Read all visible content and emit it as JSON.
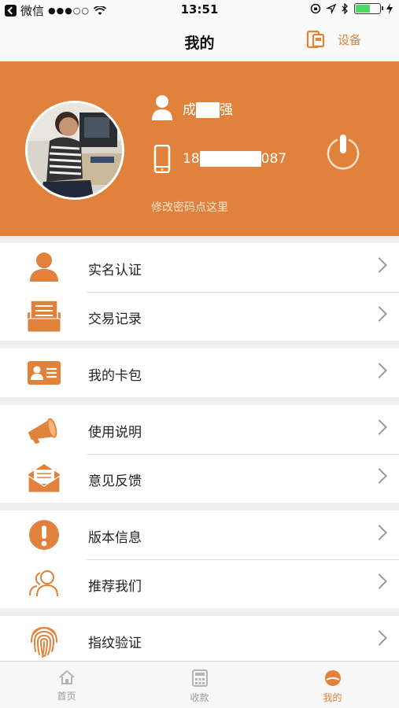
{
  "status_bar": {
    "carrier": "微信",
    "signal": "●●●○○",
    "time": "13:51"
  },
  "nav": {
    "title": "我的",
    "device_label": "设备"
  },
  "profile": {
    "name_prefix": "成",
    "name_suffix": "强",
    "phone_prefix": "18",
    "phone_suffix": "087",
    "change_password": "修改密码点这里"
  },
  "groups": [
    {
      "items": [
        {
          "label": "实名认证",
          "icon": "person-icon"
        },
        {
          "label": "交易记录",
          "icon": "records-box-icon"
        }
      ]
    },
    {
      "items": [
        {
          "label": "我的卡包",
          "icon": "id-card-icon"
        }
      ]
    },
    {
      "items": [
        {
          "label": "使用说明",
          "icon": "megaphone-icon"
        },
        {
          "label": "意见反馈",
          "icon": "envelope-icon"
        }
      ]
    },
    {
      "items": [
        {
          "label": "版本信息",
          "icon": "info-exclamation-icon"
        },
        {
          "label": "推荐我们",
          "icon": "people-icon"
        }
      ]
    },
    {
      "items": [
        {
          "label": "指纹验证",
          "icon": "fingerprint-icon"
        }
      ]
    }
  ],
  "tabs": [
    {
      "label": "首页",
      "icon": "home-icon",
      "active": false
    },
    {
      "label": "收款",
      "icon": "calculator-icon",
      "active": false
    },
    {
      "label": "我的",
      "icon": "profile-tab-icon",
      "active": true
    }
  ],
  "colors": {
    "accent": "#e0823c",
    "background": "#efefef"
  }
}
